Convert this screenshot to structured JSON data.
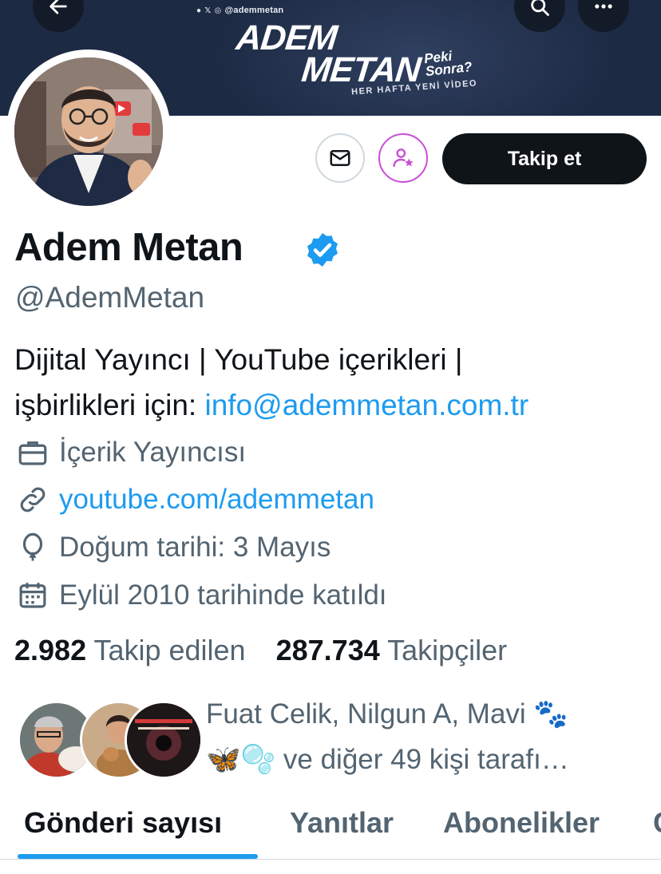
{
  "banner": {
    "social_handle": "@ademmetan",
    "title_line1": "ADEM",
    "title_line2": "METAN",
    "title_peki": "Peki",
    "title_sonra": "Sonra?",
    "subtitle": "HER HAFTA YENİ VİDEO"
  },
  "top_bar": {
    "back_icon": "arrow-left-icon",
    "search_icon": "search-icon",
    "more_icon": "more-horizontal-icon"
  },
  "actions": {
    "message_icon": "mail-icon",
    "notify_icon": "person-star-icon",
    "follow_label": "Takip et"
  },
  "profile": {
    "name": "Adem Metan",
    "handle": "@AdemMetan",
    "bio_line1": "Dijital Yayıncı | YouTube içerikleri |",
    "bio_line2_prefix": "işbirlikleri için: ",
    "bio_email": "info@ademmetan.com.tr",
    "category": "İçerik Yayıncısı",
    "website": "youtube.com/ademmetan",
    "birthday": "Doğum tarihi: 3 Mayıs",
    "joined": "Eylül 2010 tarihinde katıldı"
  },
  "stats": {
    "following_count": "2.982",
    "following_label": "Takip edilen",
    "followers_count": "287.734",
    "followers_label": "Takipçiler"
  },
  "followed_by": {
    "line1": "Fuat Celik, Nilgun A, Mavi 🐾",
    "line2": "🦋🫧 ve diğer 49 kişi tarafı…"
  },
  "tabs": [
    {
      "label": "Gönderi sayısı"
    },
    {
      "label": "Yanıtlar"
    },
    {
      "label": "Abonelikler"
    }
  ],
  "colors": {
    "accent": "#1d9bf0",
    "text": "#0f1419",
    "muted": "#536471",
    "banner": "#1d2a44",
    "notify_ring": "#c94fd6"
  }
}
